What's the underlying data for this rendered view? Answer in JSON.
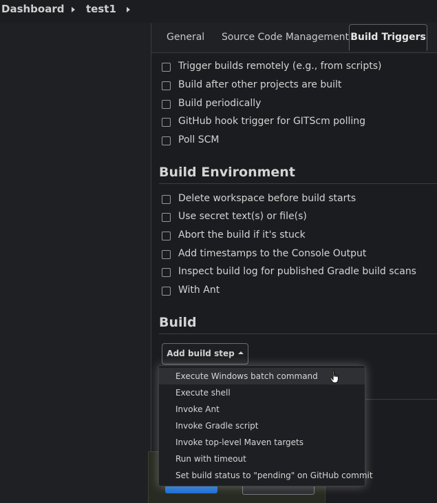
{
  "breadcrumb": {
    "items": [
      "Dashboard",
      "test1"
    ]
  },
  "tabs": [
    {
      "label": "General",
      "active": false
    },
    {
      "label": "Source Code Management",
      "active": false
    },
    {
      "label": "Build Triggers",
      "active": true
    }
  ],
  "build_triggers": {
    "options": [
      {
        "label": "Trigger builds remotely (e.g., from scripts)",
        "checked": false
      },
      {
        "label": "Build after other projects are built",
        "checked": false
      },
      {
        "label": "Build periodically",
        "checked": false
      },
      {
        "label": "GitHub hook trigger for GITScm polling",
        "checked": false
      },
      {
        "label": "Poll SCM",
        "checked": false
      }
    ]
  },
  "build_environment": {
    "title": "Build Environment",
    "options": [
      {
        "label": "Delete workspace before build starts",
        "checked": false
      },
      {
        "label": "Use secret text(s) or file(s)",
        "checked": false
      },
      {
        "label": "Abort the build if it's stuck",
        "checked": false
      },
      {
        "label": "Add timestamps to the Console Output",
        "checked": false
      },
      {
        "label": "Inspect build log for published Gradle build scans",
        "checked": false
      },
      {
        "label": "With Ant",
        "checked": false
      }
    ]
  },
  "build": {
    "title": "Build",
    "add_step_label": "Add build step",
    "menu_items": [
      "Execute Windows batch command",
      "Execute shell",
      "Invoke Ant",
      "Invoke Gradle script",
      "Invoke top-level Maven targets",
      "Run with timeout",
      "Set build status to \"pending\" on GitHub commit"
    ],
    "hovered_index": 0
  },
  "colors": {
    "background": "#1b1c1f",
    "save_button": "#1f6fd1"
  },
  "icons": [
    "breadcrumb-arrow-icon",
    "caret-up-icon",
    "hand-pointer-icon"
  ]
}
